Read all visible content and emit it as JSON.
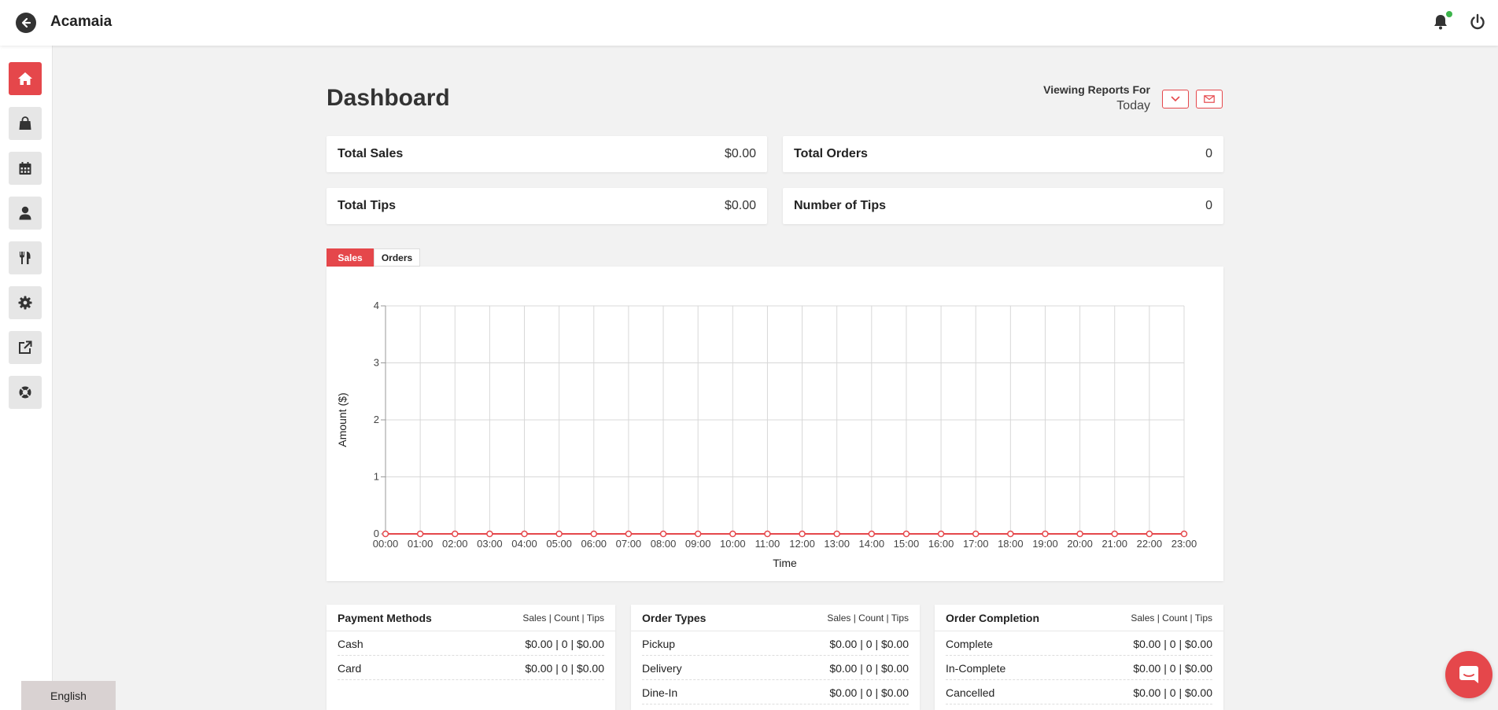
{
  "header": {
    "title": "Acamaia",
    "back_icon": "arrow-left-circle-icon",
    "bell_icon": "bell-icon",
    "power_icon": "power-icon",
    "notification_color": "#3cb44b"
  },
  "sidebar": {
    "accent_color": "#e5474b",
    "items": [
      {
        "icon": "home-icon",
        "active": true
      },
      {
        "icon": "shopping-bag-icon",
        "active": false
      },
      {
        "icon": "calendar-icon",
        "active": false
      },
      {
        "icon": "user-icon",
        "active": false
      },
      {
        "icon": "utensils-icon",
        "active": false
      },
      {
        "icon": "gear-icon",
        "active": false
      },
      {
        "icon": "external-link-icon",
        "active": false
      },
      {
        "icon": "lifebuoy-icon",
        "active": false
      }
    ]
  },
  "language": {
    "label": "English"
  },
  "dashboard": {
    "title": "Dashboard",
    "viewing_label": "Viewing Reports For",
    "viewing_value": "Today",
    "stats": [
      {
        "label": "Total Sales",
        "value": "$0.00"
      },
      {
        "label": "Total Orders",
        "value": "0"
      },
      {
        "label": "Total Tips",
        "value": "$0.00"
      },
      {
        "label": "Number of Tips",
        "value": "0"
      }
    ],
    "tabs": [
      {
        "label": "Sales",
        "active": true
      },
      {
        "label": "Orders",
        "active": false
      }
    ]
  },
  "chart_data": {
    "type": "line",
    "categories": [
      "00:00",
      "01:00",
      "02:00",
      "03:00",
      "04:00",
      "05:00",
      "06:00",
      "07:00",
      "08:00",
      "09:00",
      "10:00",
      "11:00",
      "12:00",
      "13:00",
      "14:00",
      "15:00",
      "16:00",
      "17:00",
      "18:00",
      "19:00",
      "20:00",
      "21:00",
      "22:00",
      "23:00"
    ],
    "series": [
      {
        "values": [
          0,
          0,
          0,
          0,
          0,
          0,
          0,
          0,
          0,
          0,
          0,
          0,
          0,
          0,
          0,
          0,
          0,
          0,
          0,
          0,
          0,
          0,
          0,
          0
        ],
        "color": "#e5474b"
      }
    ],
    "xlabel": "Time",
    "ylabel": "Amount ($)",
    "ylim": [
      0,
      4
    ],
    "yticks": [
      "0",
      "1",
      "2",
      "3",
      "4"
    ],
    "grid": true
  },
  "panels": [
    {
      "title": "Payment Methods",
      "columns": "Sales | Count | Tips",
      "rows": [
        {
          "label": "Cash",
          "value": "$0.00 | 0 | $0.00"
        },
        {
          "label": "Card",
          "value": "$0.00 | 0 | $0.00"
        }
      ]
    },
    {
      "title": "Order Types",
      "columns": "Sales | Count | Tips",
      "rows": [
        {
          "label": "Pickup",
          "value": "$0.00 | 0 | $0.00"
        },
        {
          "label": "Delivery",
          "value": "$0.00 | 0 | $0.00"
        },
        {
          "label": "Dine-In",
          "value": "$0.00 | 0 | $0.00"
        }
      ]
    },
    {
      "title": "Order Completion",
      "columns": "Sales | Count | Tips",
      "rows": [
        {
          "label": "Complete",
          "value": "$0.00 | 0 | $0.00"
        },
        {
          "label": "In-Complete",
          "value": "$0.00 | 0 | $0.00"
        },
        {
          "label": "Cancelled",
          "value": "$0.00 | 0 | $0.00"
        }
      ]
    }
  ],
  "chat": {
    "icon": "chat-icon"
  }
}
